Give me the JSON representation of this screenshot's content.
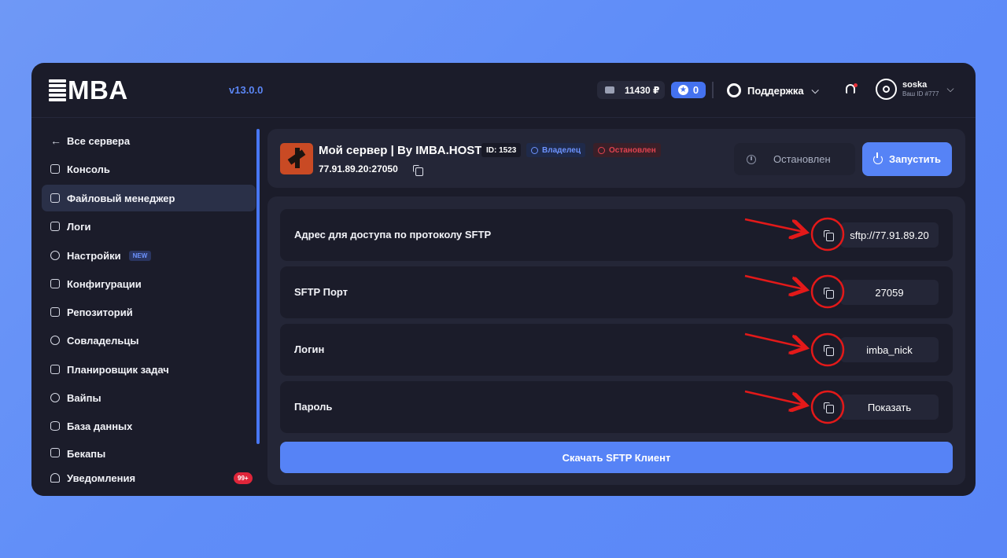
{
  "header": {
    "logo_text": "MBA",
    "version": "v13.0.0",
    "balance": "11430 ₽",
    "stars": "0",
    "support_label": "Поддержка",
    "user_name": "soska",
    "user_id": "Ваш ID #777"
  },
  "sidebar": {
    "items": [
      {
        "label": "Все сервера",
        "icon": "arrow-left-icon"
      },
      {
        "label": "Консоль",
        "icon": "monitor-icon"
      },
      {
        "label": "Файловый менеджер",
        "icon": "folder-icon"
      },
      {
        "label": "Логи",
        "icon": "logs-icon"
      },
      {
        "label": "Настройки",
        "icon": "gear-icon",
        "badge": "NEW"
      },
      {
        "label": "Конфигурации",
        "icon": "edit-icon"
      },
      {
        "label": "Репозиторий",
        "icon": "repository-icon"
      },
      {
        "label": "Совладельцы",
        "icon": "users-icon"
      },
      {
        "label": "Планировщик задач",
        "icon": "schedule-icon"
      },
      {
        "label": "Вайпы",
        "icon": "wipe-icon"
      },
      {
        "label": "База данных",
        "icon": "database-icon"
      },
      {
        "label": "Бекапы",
        "icon": "backup-icon"
      }
    ],
    "notifications": {
      "label": "Уведомления",
      "count": "99+"
    }
  },
  "server": {
    "title": "Мой сервер | By IMBA.HOST",
    "id_tag": "ID: 1523",
    "owner_tag": "Владелец",
    "status_tag": "Остановлен",
    "ip": "77.91.89.20:27050",
    "status_label": "Остановлен",
    "start_label": "Запустить"
  },
  "sftp": {
    "rows": [
      {
        "label": "Адрес для доступа по протоколу SFTP",
        "value": "sftp://77.91.89.20"
      },
      {
        "label": "SFTP Порт",
        "value": "27059"
      },
      {
        "label": "Логин",
        "value": "imba_nick"
      },
      {
        "label": "Пароль",
        "value": "Показать"
      }
    ],
    "download_label": "Скачать SFTP Клиент"
  },
  "colors": {
    "accent": "#5683f6",
    "danger": "#e0263a",
    "annotation": "#e31919",
    "background": "#1b1c2a"
  }
}
